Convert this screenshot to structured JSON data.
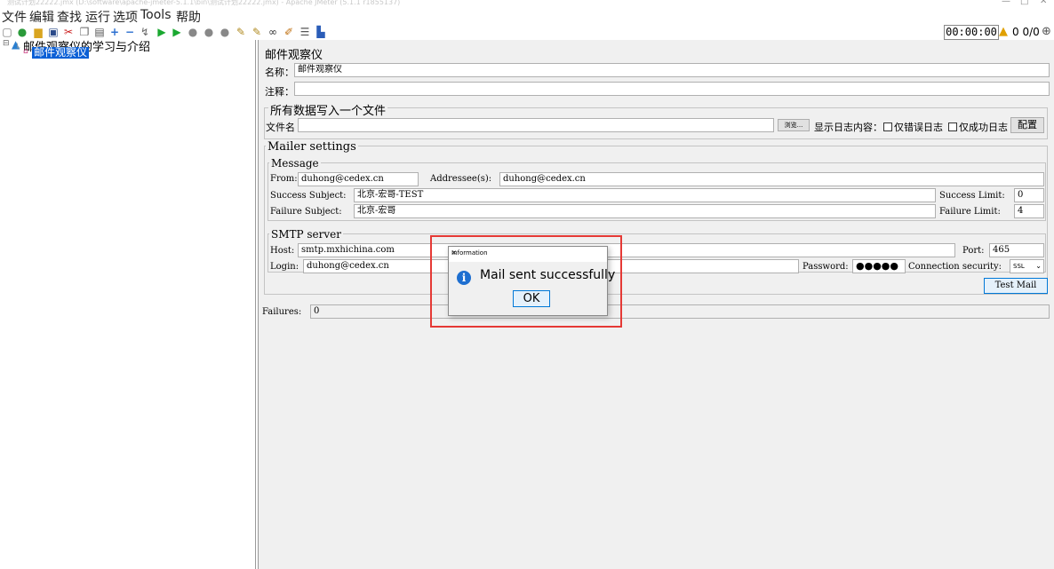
{
  "titlebar": {
    "title": "测试计划22222.jmx (D:\\software\\apache-jmeter-5.1.1\\bin\\测试计划22222.jmx) - Apache JMeter (5.1.1 r1855137)",
    "minimize": "—",
    "maximize": "□",
    "close": "✕"
  },
  "menu": [
    "文件",
    "编辑",
    "查找",
    "运行",
    "选项",
    "Tools",
    "帮助"
  ],
  "toolbar": {
    "timer": "00:00:00",
    "counts": "0 0/0"
  },
  "tree": {
    "root_label": "邮件观察仪的学习与介绍",
    "child_label": "邮件观察仪"
  },
  "panel": {
    "heading": "邮件观察仪",
    "name_label": "名称：",
    "name_value": "邮件观察仪",
    "comment_label": "注释：",
    "comment_value": "",
    "file_section": "所有数据写入一个文件",
    "filename_label": "文件名",
    "filename_value": "",
    "browse_button": "浏览...",
    "log_content_label": "显示日志内容：",
    "errors_only": "仅错误日志",
    "success_only": "仅成功日志",
    "config_button": "配置",
    "mailer_settings": "Mailer settings",
    "message_group": "Message",
    "from_label": "From:",
    "from_value": "duhong@cedex.cn",
    "addressee_label": "Addressee(s):",
    "addressee_value": "duhong@cedex.cn",
    "success_subject_label": "Success Subject:",
    "success_subject_value": "北京-宏哥-TEST",
    "success_limit_label": "Success Limit:",
    "success_limit_value": "0",
    "failure_subject_label": "Failure Subject:",
    "failure_subject_value": "北京-宏哥",
    "failure_limit_label": "Failure Limit:",
    "failure_limit_value": "4",
    "smtp_group": "SMTP server",
    "host_label": "Host:",
    "host_value": "smtp.mxhichina.com",
    "port_label": "Port:",
    "port_value": "465",
    "login_label": "Login:",
    "login_value": "duhong@cedex.cn",
    "password_label": "Password:",
    "password_value": "●●●●●",
    "security_label": "Connection security:",
    "security_value": "SSL",
    "test_mail_button": "Test Mail",
    "failures_label": "Failures:",
    "failures_value": "0"
  },
  "dialog": {
    "title": "Information",
    "message": "Mail sent successfully",
    "ok_button": "OK",
    "close": "✕"
  },
  "colors": {
    "selection": "#0a5fd6",
    "highlight_border": "#e53935",
    "dialog_info": "#1e6fd0"
  }
}
